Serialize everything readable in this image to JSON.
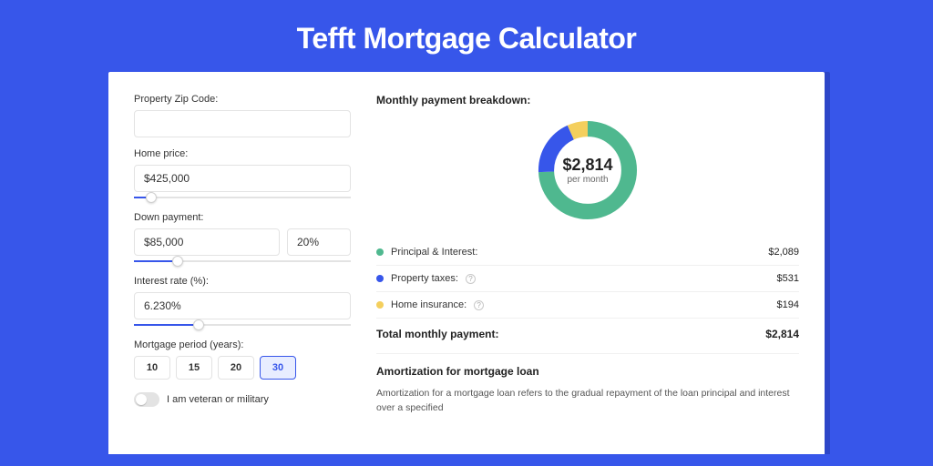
{
  "title": "Tefft Mortgage Calculator",
  "form": {
    "zip": {
      "label": "Property Zip Code:",
      "value": ""
    },
    "price": {
      "label": "Home price:",
      "value": "$425,000",
      "slider_pct": 8
    },
    "down": {
      "label": "Down payment:",
      "amount": "$85,000",
      "pct": "20%",
      "slider_pct": 20
    },
    "rate": {
      "label": "Interest rate (%):",
      "value": "6.230%",
      "slider_pct": 30
    },
    "period": {
      "label": "Mortgage period (years):",
      "options": [
        "10",
        "15",
        "20",
        "30"
      ],
      "selected": "30"
    },
    "veteran": {
      "label": "I am veteran or military",
      "on": false
    }
  },
  "breakdown": {
    "title": "Monthly payment breakdown:",
    "center_value": "$2,814",
    "center_sub": "per month",
    "items": [
      {
        "label": "Principal & Interest:",
        "value": "$2,089",
        "color": "#4fb88f",
        "info": false
      },
      {
        "label": "Property taxes:",
        "value": "$531",
        "color": "#3756ea",
        "info": true
      },
      {
        "label": "Home insurance:",
        "value": "$194",
        "color": "#f4cf5d",
        "info": true
      }
    ],
    "total_label": "Total monthly payment:",
    "total_value": "$2,814"
  },
  "amort": {
    "title": "Amortization for mortgage loan",
    "text": "Amortization for a mortgage loan refers to the gradual repayment of the loan principal and interest over a specified"
  },
  "chart_data": {
    "type": "pie",
    "title": "Monthly payment breakdown",
    "series": [
      {
        "name": "Principal & Interest",
        "value": 2089,
        "color": "#4fb88f"
      },
      {
        "name": "Property taxes",
        "value": 531,
        "color": "#3756ea"
      },
      {
        "name": "Home insurance",
        "value": 194,
        "color": "#f4cf5d"
      }
    ],
    "total": 2814,
    "center_label": "$2,814 per month"
  }
}
